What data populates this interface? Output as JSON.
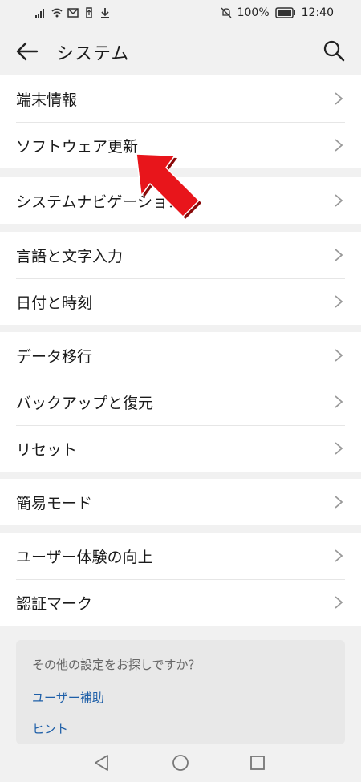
{
  "statusbar": {
    "battery": "100%",
    "time": "12:40"
  },
  "header": {
    "title": "システム"
  },
  "groups": [
    {
      "items": [
        "端末情報",
        "ソフトウェア更新"
      ]
    },
    {
      "items": [
        "システムナビゲーション"
      ]
    },
    {
      "items": [
        "言語と文字入力",
        "日付と時刻"
      ]
    },
    {
      "items": [
        "データ移行",
        "バックアップと復元",
        "リセット"
      ]
    },
    {
      "items": [
        "簡易モード"
      ]
    },
    {
      "items": [
        "ユーザー体験の向上",
        "認証マーク"
      ]
    }
  ],
  "more": {
    "question": "その他の設定をお探しですか？",
    "links": [
      "ユーザー補助",
      "ヒント"
    ]
  },
  "annotation": {
    "color": "#e8151b",
    "target": "ソフトウェア更新"
  }
}
